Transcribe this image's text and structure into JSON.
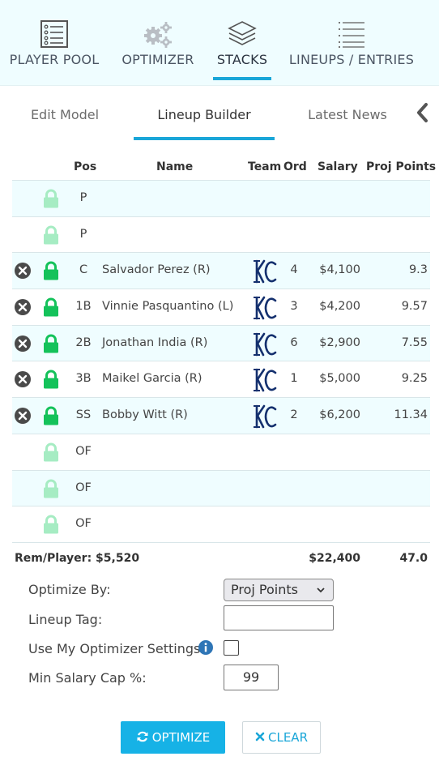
{
  "topnav": {
    "items": [
      {
        "label": "PLAYER POOL",
        "icon": "player-pool-list-icon"
      },
      {
        "label": "OPTIMIZER",
        "icon": "gears-icon"
      },
      {
        "label": "STACKS",
        "icon": "layers-icon",
        "active": true
      },
      {
        "label": "LINEUPS / ENTRIES",
        "icon": "list-lines-icon"
      }
    ]
  },
  "subtabs": [
    {
      "label": "Edit Model"
    },
    {
      "label": "Lineup Builder",
      "active": true
    },
    {
      "label": "Latest News"
    }
  ],
  "table": {
    "headers": {
      "pos": "Pos",
      "name": "Name",
      "team": "Team",
      "ord": "Ord",
      "salary": "Salary",
      "proj": "Proj Points"
    },
    "rows": [
      {
        "pos": "P",
        "name": "",
        "team": "",
        "ord": "",
        "salary": "",
        "proj": "",
        "locked": false
      },
      {
        "pos": "P",
        "name": "",
        "team": "",
        "ord": "",
        "salary": "",
        "proj": "",
        "locked": false
      },
      {
        "pos": "C",
        "name": "Salvador Perez (R)",
        "team": "KC",
        "ord": "4",
        "salary": "$4,100",
        "proj": "9.3",
        "locked": true
      },
      {
        "pos": "1B",
        "name": "Vinnie Pasquantino (L)",
        "team": "KC",
        "ord": "3",
        "salary": "$4,200",
        "proj": "9.57",
        "locked": true
      },
      {
        "pos": "2B",
        "name": "Jonathan India (R)",
        "team": "KC",
        "ord": "6",
        "salary": "$2,900",
        "proj": "7.55",
        "locked": true
      },
      {
        "pos": "3B",
        "name": "Maikel Garcia (R)",
        "team": "KC",
        "ord": "1",
        "salary": "$5,000",
        "proj": "9.25",
        "locked": true
      },
      {
        "pos": "SS",
        "name": "Bobby Witt (R)",
        "team": "KC",
        "ord": "2",
        "salary": "$6,200",
        "proj": "11.34",
        "locked": true
      },
      {
        "pos": "OF",
        "name": "",
        "team": "",
        "ord": "",
        "salary": "",
        "proj": "",
        "locked": false
      },
      {
        "pos": "OF",
        "name": "",
        "team": "",
        "ord": "",
        "salary": "",
        "proj": "",
        "locked": false
      },
      {
        "pos": "OF",
        "name": "",
        "team": "",
        "ord": "",
        "salary": "",
        "proj": "",
        "locked": false
      }
    ],
    "totals": {
      "rem_player": "Rem/Player: $5,520",
      "salary": "$22,400",
      "proj": "47.0"
    }
  },
  "form": {
    "optimize_by_label": "Optimize By:",
    "optimize_by_value": "Proj Points",
    "lineup_tag_label": "Lineup Tag:",
    "lineup_tag_value": "",
    "use_settings_label": "Use My Optimizer Settings",
    "use_settings_checked": false,
    "min_salary_label": "Min Salary Cap %:",
    "min_salary_value": "99"
  },
  "buttons": {
    "optimize": "OPTIMIZE",
    "clear": "CLEAR"
  },
  "colors": {
    "accent": "#1aa6d8",
    "lock_active": "#14c25a",
    "lock_inactive": "#a6ecc3",
    "team_logo": "#14306e",
    "row_alt": "#effdff"
  }
}
